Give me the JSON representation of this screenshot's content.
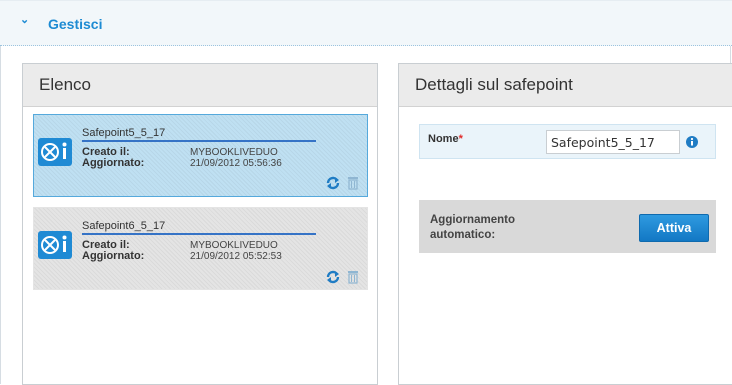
{
  "header": {
    "title": "Gestisci",
    "chevron_icon": "chevron-down-icon"
  },
  "list_panel": {
    "title": "Elenco",
    "items": [
      {
        "name": "Safepoint5_5_17",
        "created_label": "Creato il:",
        "created_value": "MYBOOKLIVEDUO",
        "updated_label": "Aggiornato:",
        "updated_value": "21/09/2012 05:56:36",
        "selected": true
      },
      {
        "name": "Safepoint6_5_17",
        "created_label": "Creato il:",
        "created_value": "MYBOOKLIVEDUO",
        "updated_label": "Aggiornato:",
        "updated_value": "21/09/2012 05:52:53",
        "selected": false
      }
    ]
  },
  "details_panel": {
    "title": "Dettagli sul safepoint",
    "name_label": "Nome",
    "required_mark": "*",
    "name_value": "Safepoint5_5_17",
    "auto_update_label": "Aggiornamento automatico:",
    "activate_button": "Attiva"
  },
  "colors": {
    "accent": "#1d8bd3",
    "selected_bg": "#bfe0f2",
    "selected_border": "#55a9dc",
    "button_blue": "#1f86d0",
    "required": "#e02a2a"
  }
}
